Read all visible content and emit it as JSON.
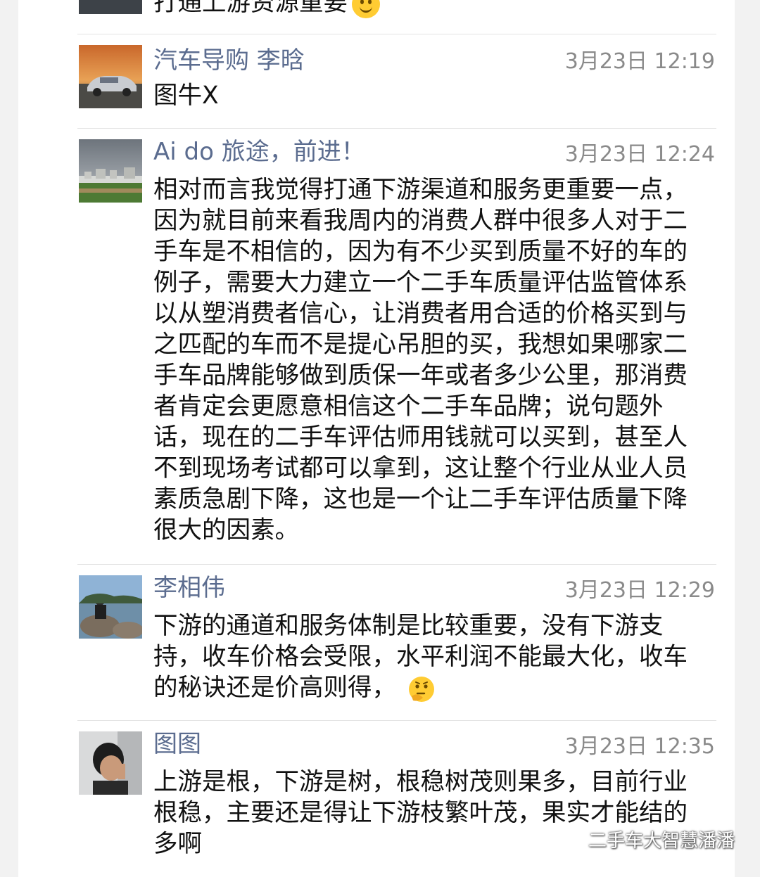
{
  "top_partial": {
    "text": "打通上游资源重要"
  },
  "messages": [
    {
      "sender": "汽车导购 李晗",
      "time": "3月23日 12:19",
      "text": "图牛X"
    },
    {
      "sender": "Ai   do 旅途，前进！",
      "time": "3月23日 12:24",
      "text": "相对而言我觉得打通下游渠道和服务更重要一点，因为就目前来看我周内的消费人群中很多人对于二手车是不相信的，因为有不少买到质量不好的车的例子，需要大力建立一个二手车质量评估监管体系以从塑消费者信心，让消费者用合适的价格买到与之匹配的车而不是提心吊胆的买，我想如果哪家二手车品牌能够做到质保一年或者多少公里，那消费者肯定会更愿意相信这个二手车品牌；说句题外话，现在的二手车评估师用钱就可以买到，甚至人不到现场考试都可以拿到，这让整个行业从业人员素质急剧下降，这也是一个让二手车评估质量下降很大的因素。"
    },
    {
      "sender": "李相伟",
      "time": "3月23日 12:29",
      "text": "下游的通道和服务体制是比较重要，没有下游支持，收车价格会受限，水平利润不能最大化，收车的秘诀还是价高则得，"
    },
    {
      "sender": "图图",
      "time": "3月23日 12:35",
      "text": "上游是根，下游是树，根稳树茂则果多，目前行业根稳，主要还是得让下游枝繁叶茂，果实才能结的多啊"
    }
  ],
  "watermark": {
    "text": "二手车大智慧潘潘"
  },
  "colors": {
    "name": "#5b6c8f",
    "time": "#8a8a8a",
    "text": "#111111",
    "divider": "#e3e3e3"
  }
}
